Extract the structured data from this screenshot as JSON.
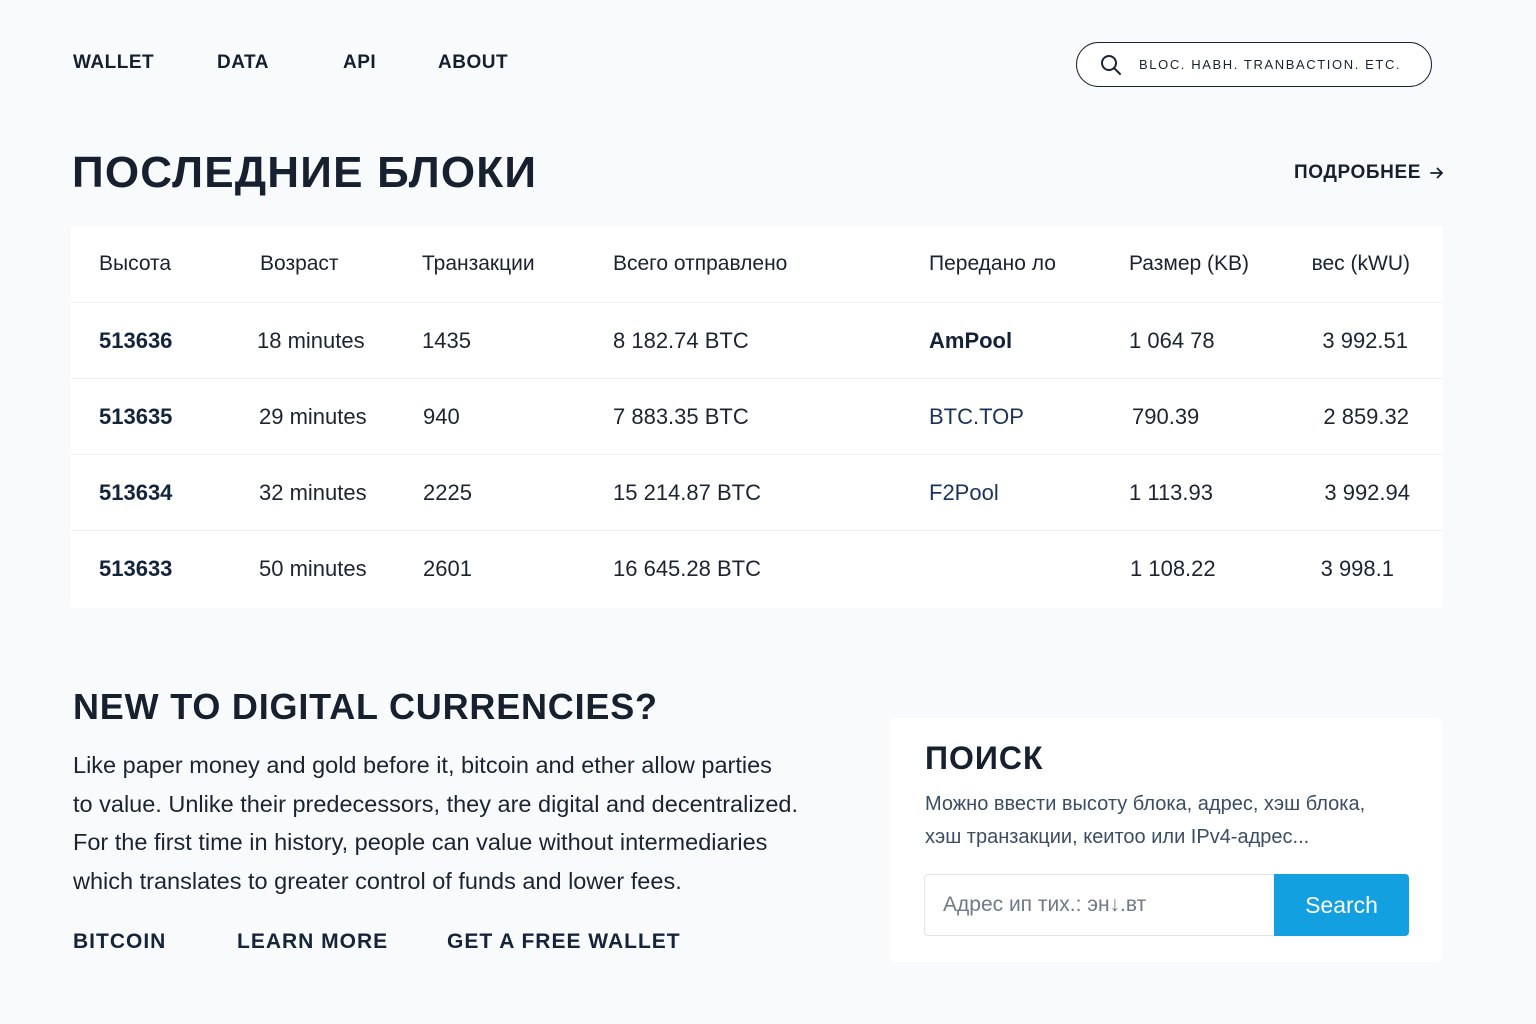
{
  "nav": {
    "items": [
      "WALLET",
      "DATA",
      "API",
      "ABOUT"
    ],
    "search_placeholder": "BLOC. HABH. TRANBACTION. ETC."
  },
  "blocks": {
    "title": "ПОСЛЕДНИЕ БЛОКИ",
    "more_label": "ПОДРОБНЕЕ",
    "columns": [
      "Высота",
      "Возраст",
      "Транзакции",
      "Всего отправлено",
      "Передано ло",
      "Размер (KB)",
      "вес (kWU)"
    ],
    "rows": [
      {
        "height": "513636",
        "age": "18 minutes",
        "tx": "1435",
        "sent": "8 182.74 BTC",
        "pool": "AmPool",
        "size": "1 064 78",
        "weight": "3 992.51"
      },
      {
        "height": "513635",
        "age": "29 minutes",
        "tx": "940",
        "sent": "7 883.35 BTC",
        "pool": "BTC.TOP",
        "size": "790.39",
        "weight": "2 859.32"
      },
      {
        "height": "513634",
        "age": "32 minutes",
        "tx": "2225",
        "sent": "15 214.87 BTC",
        "pool": "F2Pool",
        "size": "1 113.93",
        "weight": "3 992.94"
      },
      {
        "height": "513633",
        "age": "50 minutes",
        "tx": "2601",
        "sent": "16 645.28 BTC",
        "pool": "",
        "size": "1 108.22",
        "weight": "3 998.1"
      }
    ]
  },
  "intro": {
    "title": "NEW TO DIGITAL CURRENCIES?",
    "lines": [
      "Like paper money and gold before it, bitcoin and ether allow parties",
      "to value. Unlike their predecessors, they are digital and decentralized.",
      "For the first time in history, people can value without intermediaries",
      "which translates to greater control of funds and lower fees."
    ],
    "links": [
      "BITCOIN",
      "LEARN MORE",
      "GET A FREE WALLET"
    ]
  },
  "search_card": {
    "title": "ПОИСК",
    "description_lines": [
      "Можно ввести высоту блока, адрес, хэш блока,",
      "хэш транзакции, кеитоо или IPv4-адрес..."
    ],
    "input_placeholder": "Адрес ип тих.: эн↓.вт",
    "button_label": "Search",
    "button_color": "#12a0e0"
  },
  "icons": {
    "search": "search-icon",
    "arrow": "arrow-right-icon"
  }
}
